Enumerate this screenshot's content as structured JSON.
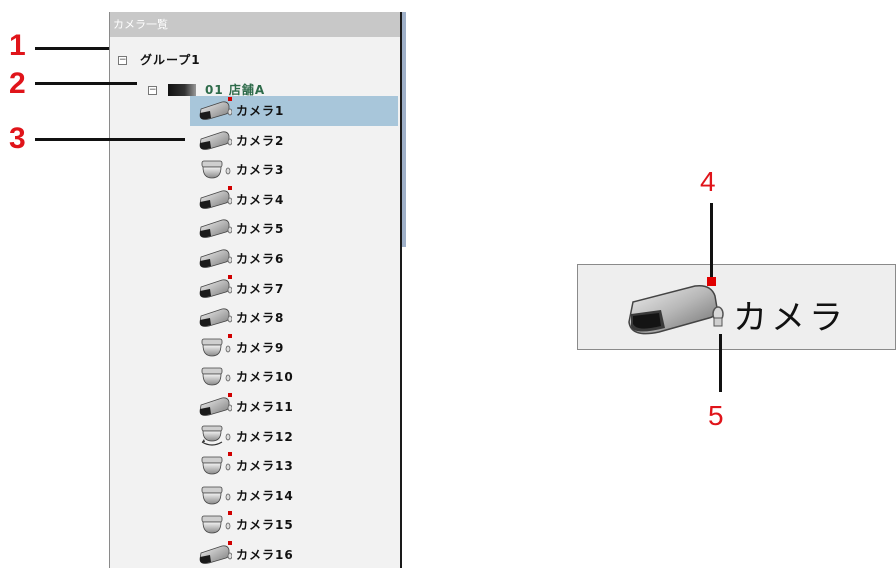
{
  "panel": {
    "header": "カメラ一覧",
    "group_label": "グループ1",
    "store_label": "01 店舗A",
    "cameras": [
      {
        "label": "カメラ1",
        "icon": "box-camera-icon",
        "recording": true,
        "selected": true
      },
      {
        "label": "カメラ2",
        "icon": "box-camera-icon",
        "recording": false,
        "selected": false
      },
      {
        "label": "カメラ3",
        "icon": "dome-camera-icon",
        "recording": false,
        "selected": false
      },
      {
        "label": "カメラ4",
        "icon": "box-camera-icon",
        "recording": true,
        "selected": false
      },
      {
        "label": "カメラ5",
        "icon": "box-camera-icon",
        "recording": false,
        "selected": false
      },
      {
        "label": "カメラ6",
        "icon": "box-camera-icon",
        "recording": false,
        "selected": false
      },
      {
        "label": "カメラ7",
        "icon": "box-camera-icon",
        "recording": true,
        "selected": false
      },
      {
        "label": "カメラ8",
        "icon": "box-camera-icon",
        "recording": false,
        "selected": false
      },
      {
        "label": "カメラ9",
        "icon": "dome-camera-icon",
        "recording": true,
        "selected": false
      },
      {
        "label": "カメラ10",
        "icon": "dome-camera-icon",
        "recording": false,
        "selected": false
      },
      {
        "label": "カメラ11",
        "icon": "box-camera-icon",
        "recording": true,
        "selected": false
      },
      {
        "label": "カメラ12",
        "icon": "ptz-camera-icon",
        "recording": false,
        "selected": false
      },
      {
        "label": "カメラ13",
        "icon": "dome-camera-icon",
        "recording": true,
        "selected": false
      },
      {
        "label": "カメラ14",
        "icon": "dome-camera-icon",
        "recording": false,
        "selected": false
      },
      {
        "label": "カメラ15",
        "icon": "dome-camera-icon",
        "recording": true,
        "selected": false
      },
      {
        "label": "カメラ16",
        "icon": "box-camera-icon",
        "recording": true,
        "selected": false
      }
    ]
  },
  "callouts": [
    "1",
    "2",
    "3",
    "4",
    "5"
  ],
  "zoom": {
    "label": "カメラ",
    "icon": "box-camera-icon",
    "recording": true
  },
  "colors": {
    "selection": "#a8c6da",
    "recording": "#d00000",
    "callout": "#e0141a",
    "store_text": "#2e6b4a"
  }
}
